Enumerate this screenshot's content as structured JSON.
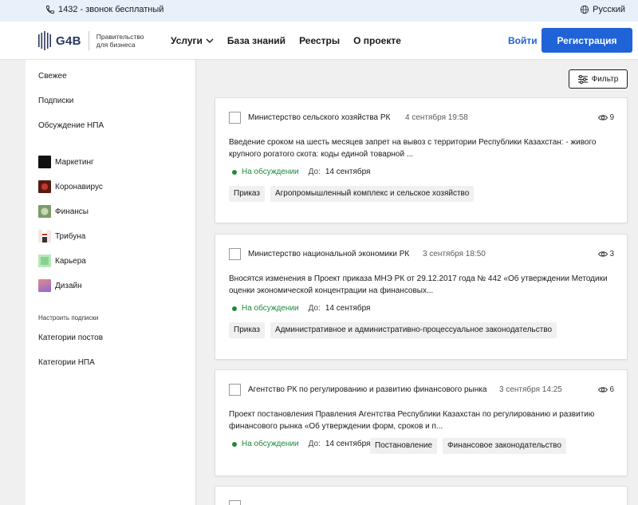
{
  "topbar": {
    "phone": "1432 - звонок бесплатный",
    "language": "Русский"
  },
  "header": {
    "brand": "G4B",
    "tagline": "Правительство для бизнеса",
    "nav": [
      "Услуги",
      "База знаний",
      "Реестры",
      "О проекте"
    ],
    "login": "Войти",
    "register": "Регистрация",
    "accent": "#1f63d6"
  },
  "sidebar": {
    "top_items": [
      "Свежее",
      "Подписки",
      "Обсуждение НПА"
    ],
    "categories": [
      {
        "label": "Маркетинг",
        "icon": "marketing-icon"
      },
      {
        "label": "Коронавирус",
        "icon": "coronavirus-icon"
      },
      {
        "label": "Финансы",
        "icon": "finance-icon"
      },
      {
        "label": "Трибуна",
        "icon": "tribune-icon"
      },
      {
        "label": "Карьера",
        "icon": "career-icon"
      },
      {
        "label": "Дизайн",
        "icon": "design-icon"
      }
    ],
    "caption": "Настроить подписки",
    "settings_items": [
      "Категории постов",
      "Категории НПА"
    ]
  },
  "filter": {
    "label": "Фильтр"
  },
  "cards": [
    {
      "org": "Министерство сельского хозяйства РК",
      "date": "4 сентября 19:58",
      "views": "9",
      "text": "Введение сроком на шесть месяцев запрет на вывоз с территории Республики Казахстан: - живого крупного рогатого скота: коды единой товарной ...",
      "status": "На обсуждении",
      "due_label": "До:",
      "due": "14 сентября",
      "tags": [
        "Приказ",
        "Агропромышленный комплекс и сельское хозяйство"
      ]
    },
    {
      "org": "Министерство национальной экономики РК",
      "date": "3 сентября 18:50",
      "views": "3",
      "text": "Вносятся изменения в Проект приказа МНЭ РК от 29.12.2017 года № 442 «Об утверждении Методики оценки экономической концентрации на финансовых...",
      "status": "На обсуждении",
      "due_label": "До:",
      "due": "14 сентября",
      "tags": [
        "Приказ",
        "Административное и административно-процессуальное законодательство"
      ]
    },
    {
      "org": "Агентство РК по регулированию и развитию финансового рынка",
      "date": "3 сентября 14:25",
      "views": "6",
      "text": "Проект постановления Правления Агентства Республики Казахстан по регулированию и развитию финансового рынка «Об утверждении форм, сроков и п...",
      "status": "На обсуждении",
      "due_label": "До:",
      "due": "14 сентября",
      "tags": [
        "Постановление",
        "Финансовое законодательство"
      ]
    }
  ],
  "status_color": "#1e8a3c"
}
